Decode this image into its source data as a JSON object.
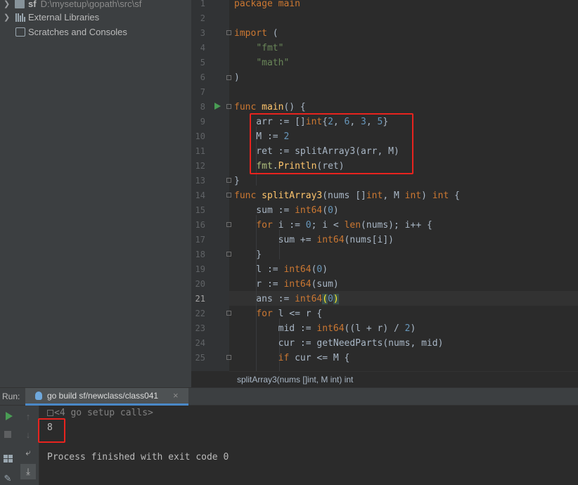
{
  "project_tree": [
    {
      "name": "sf",
      "path": "D:\\mysetup\\gopath\\src\\sf",
      "expandable": true,
      "icon": "folder-icon"
    },
    {
      "name": "External Libraries",
      "expandable": true,
      "icon": "library-icon"
    },
    {
      "name": "Scratches and Consoles",
      "expandable": false,
      "icon": "scratch-icon"
    }
  ],
  "editor": {
    "current_line": 21,
    "line_numbers": [
      "1",
      "2",
      "3",
      "4",
      "5",
      "6",
      "7",
      "8",
      "9",
      "10",
      "11",
      "12",
      "13",
      "14",
      "15",
      "16",
      "17",
      "18",
      "19",
      "20",
      "21",
      "22",
      "23",
      "24",
      "25"
    ],
    "lines": [
      "package main",
      "",
      "import (",
      "    \"fmt\"",
      "    \"math\"",
      ")",
      "",
      "func main() {",
      "    arr := []int{2, 6, 3, 5}",
      "    M := 2",
      "    ret := splitArray3(arr, M)",
      "    fmt.Println(ret)",
      "}",
      "func splitArray3(nums []int, M int) int {",
      "    sum := int64(0)",
      "    for i := 0; i < len(nums); i++ {",
      "        sum += int64(nums[i])",
      "    }",
      "    l := int64(0)",
      "    r := int64(sum)",
      "    ans := int64(0)",
      "    for l <= r {",
      "        mid := int64((l + r) / 2)",
      "        cur := getNeedParts(nums, mid)",
      "        if cur <= M {"
    ]
  },
  "breadcrumb": "splitArray3(nums []int, M int) int",
  "run_panel": {
    "label": "Run:",
    "tab_title": "go build sf/newclass/class041",
    "close_symbol": "×",
    "console_calls": "<4 go setup calls>",
    "output": "8",
    "finish_message": "Process finished with exit code 0"
  },
  "colors": {
    "annotation_box": "#e8231e",
    "keyword": "#cc7832",
    "string": "#6a8759",
    "number": "#6897bb",
    "function": "#ffc66d"
  }
}
